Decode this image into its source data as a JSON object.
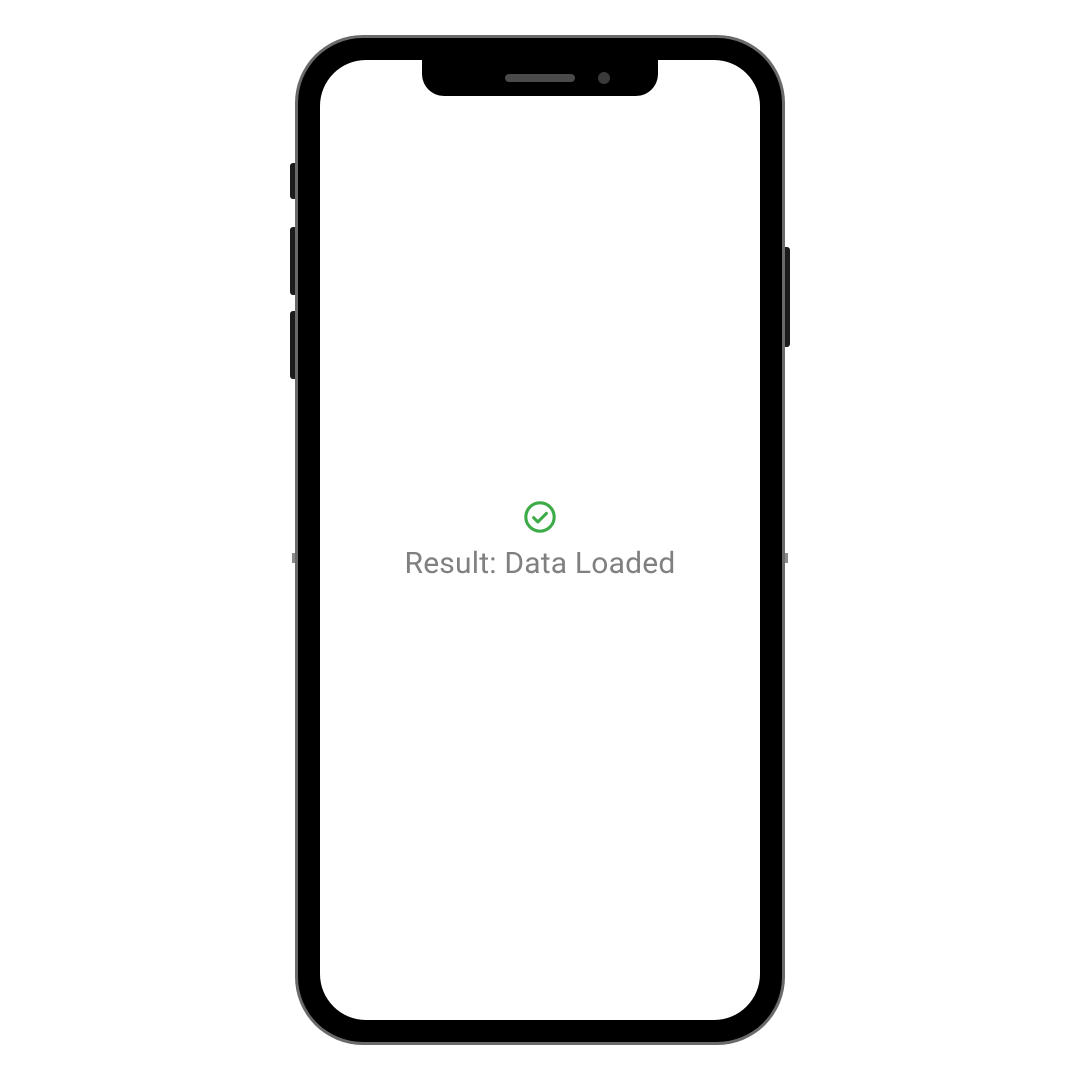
{
  "status": {
    "icon": "check-circle-icon",
    "icon_color": "#3DAB47",
    "text": "Result: Data Loaded"
  }
}
